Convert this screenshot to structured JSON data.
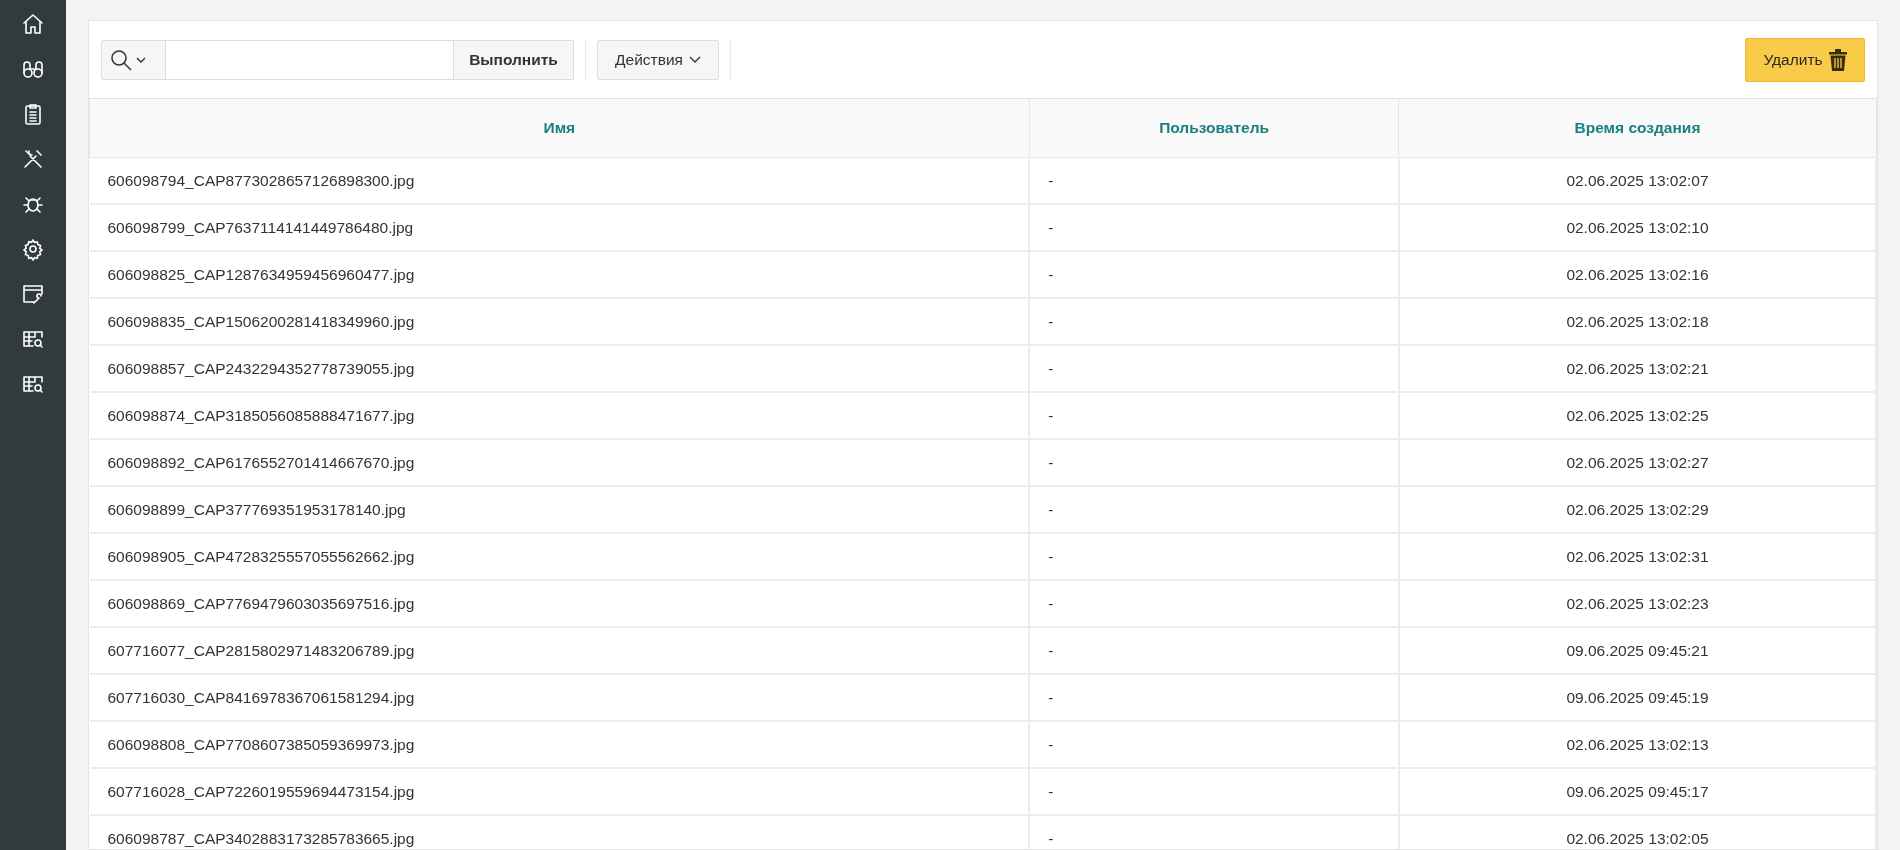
{
  "toolbar": {
    "go_button": "Выполнить",
    "actions_button": "Действия",
    "delete_button": "Удалить"
  },
  "table": {
    "columns": [
      "Имя",
      "Пользователь",
      "Время создания"
    ],
    "rows": [
      [
        "606098794_CAP8773028657126898300.jpg",
        "-",
        "02.06.2025 13:02:07"
      ],
      [
        "606098799_CAP7637114141449786480.jpg",
        "-",
        "02.06.2025 13:02:10"
      ],
      [
        "606098825_CAP1287634959456960477.jpg",
        "-",
        "02.06.2025 13:02:16"
      ],
      [
        "606098835_CAP1506200281418349960.jpg",
        "-",
        "02.06.2025 13:02:18"
      ],
      [
        "606098857_CAP2432294352778739055.jpg",
        "-",
        "02.06.2025 13:02:21"
      ],
      [
        "606098874_CAP3185056085888471677.jpg",
        "-",
        "02.06.2025 13:02:25"
      ],
      [
        "606098892_CAP6176552701414667670.jpg",
        "-",
        "02.06.2025 13:02:27"
      ],
      [
        "606098899_CAP377769351953178140.jpg",
        "-",
        "02.06.2025 13:02:29"
      ],
      [
        "606098905_CAP4728325557055562662.jpg",
        "-",
        "02.06.2025 13:02:31"
      ],
      [
        "606098869_CAP7769479603035697516.jpg",
        "-",
        "02.06.2025 13:02:23"
      ],
      [
        "607716077_CAP2815802971483206789.jpg",
        "-",
        "09.06.2025 09:45:21"
      ],
      [
        "607716030_CAP8416978367061581294.jpg",
        "-",
        "09.06.2025 09:45:19"
      ],
      [
        "606098808_CAP7708607385059369973.jpg",
        "-",
        "02.06.2025 13:02:13"
      ],
      [
        "607716028_CAP7226019559694473154.jpg",
        "-",
        "09.06.2025 09:45:17"
      ],
      [
        "606098787_CAP3402883173285783665.jpg",
        "-",
        "02.06.2025 13:02:05"
      ]
    ]
  }
}
